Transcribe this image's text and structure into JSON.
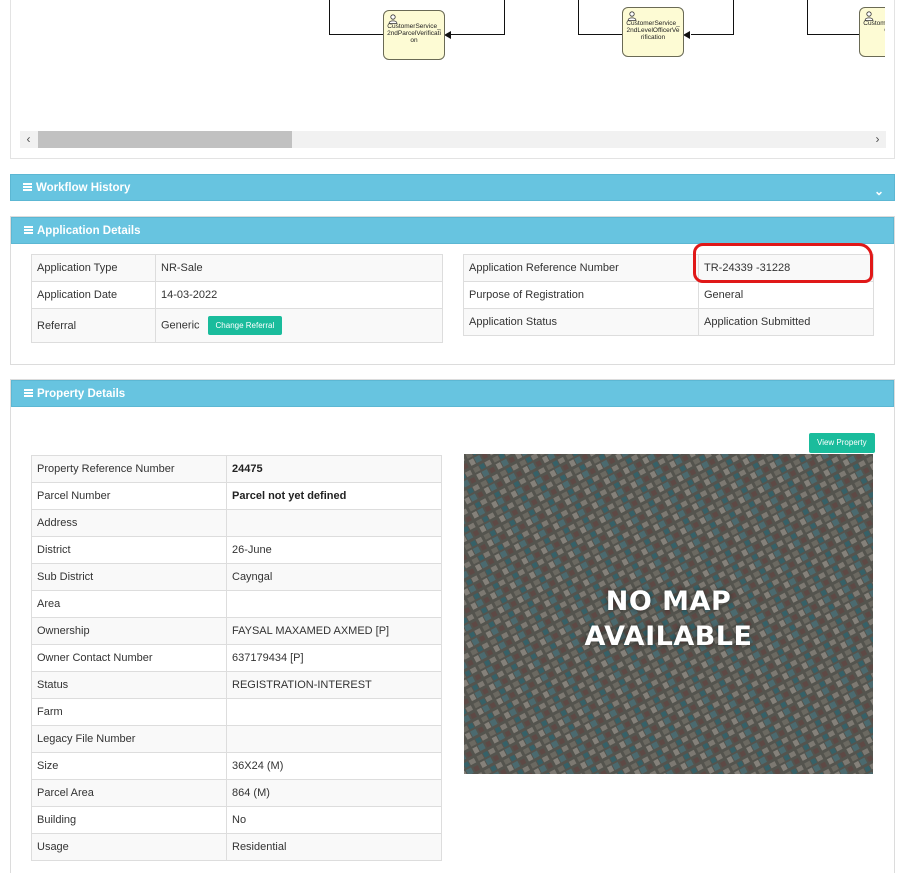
{
  "workflow": {
    "nodes": [
      {
        "label": "CustomerService_2ndParcelVerification"
      },
      {
        "label": "CustomerService_2ndLevelOfficerVerification"
      },
      {
        "label": "CustomerService_Cl..."
      }
    ]
  },
  "panels": {
    "workflow_history": "Workflow History",
    "application_details": "Application Details",
    "property_details": "Property Details"
  },
  "application": {
    "left": [
      {
        "label": "Application Type",
        "value": "NR-Sale"
      },
      {
        "label": "Application Date",
        "value": "14-03-2022"
      },
      {
        "label": "Referral",
        "value": "Generic"
      }
    ],
    "change_referral_label": "Change Referral",
    "right": [
      {
        "label": "Application Reference Number",
        "value": "TR-24339 -31228"
      },
      {
        "label": "Purpose of Registration",
        "value": "General"
      },
      {
        "label": "Application Status",
        "value": "Application Submitted"
      }
    ]
  },
  "property": {
    "view_property_label": "View Property",
    "rows": [
      {
        "label": "Property Reference Number",
        "value": "24475",
        "bold": true
      },
      {
        "label": "Parcel Number",
        "value": "Parcel not yet defined",
        "bold": true
      },
      {
        "label": "Address",
        "value": ""
      },
      {
        "label": "District",
        "value": "26-June"
      },
      {
        "label": "Sub District",
        "value": "Cayngal"
      },
      {
        "label": "Area",
        "value": ""
      },
      {
        "label": "Ownership",
        "value": "FAYSAL MAXAMED AXMED [P]"
      },
      {
        "label": "Owner Contact Number",
        "value": "637179434 [P]"
      },
      {
        "label": "Status",
        "value": "REGISTRATION-INTEREST"
      },
      {
        "label": "Farm",
        "value": ""
      },
      {
        "label": "Legacy File Number",
        "value": ""
      },
      {
        "label": "Size",
        "value": "36X24 (M)"
      },
      {
        "label": "Parcel Area",
        "value": "864 (M)"
      },
      {
        "label": "Building",
        "value": "No"
      },
      {
        "label": "Usage",
        "value": "Residential"
      }
    ],
    "map_line1": "NO MAP",
    "map_line2": "AVAILABLE"
  }
}
